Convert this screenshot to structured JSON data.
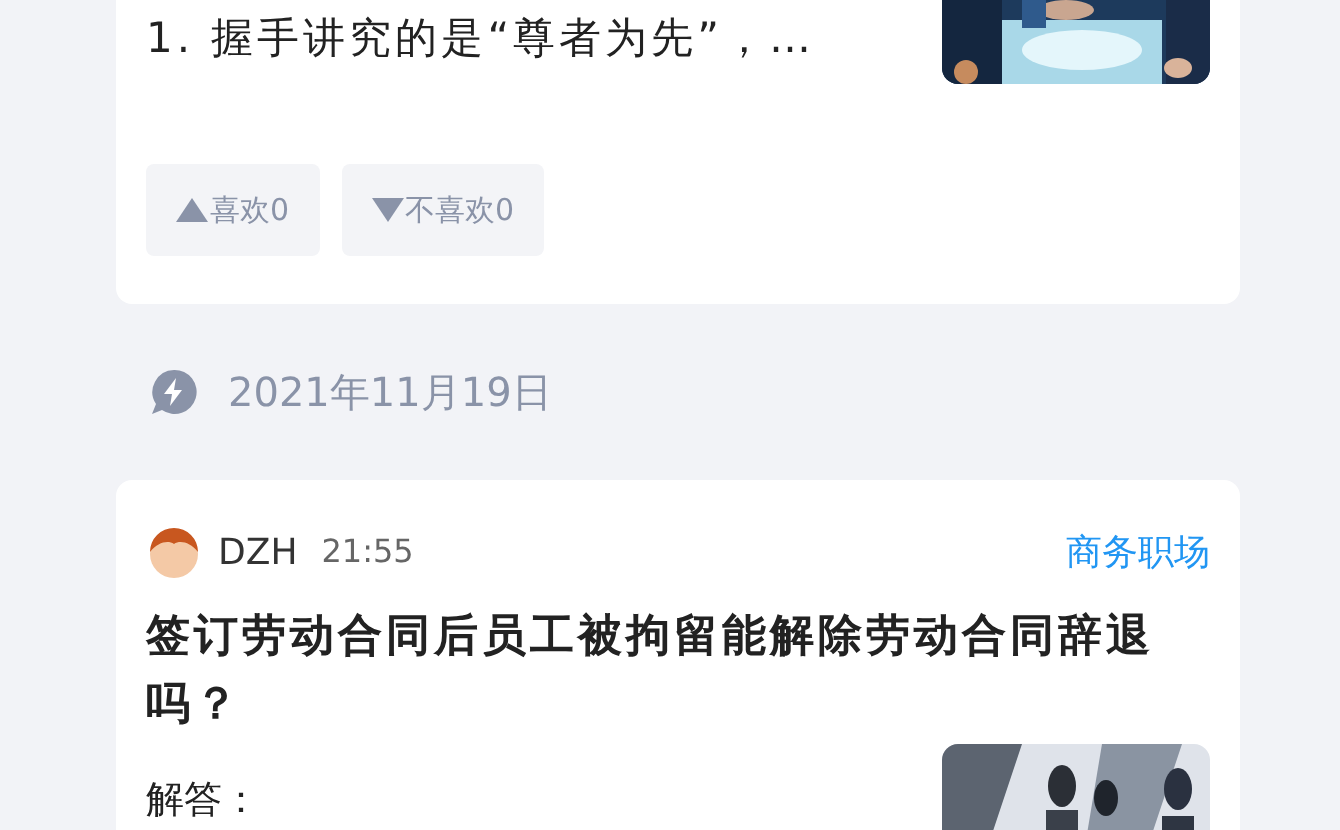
{
  "cards": [
    {
      "kind": "summary",
      "excerpt": "1. 握手讲究的是“尊者为先”，…",
      "reactions": [
        {
          "kind": "up",
          "label": "喜欢0"
        },
        {
          "kind": "down",
          "label": "不喜欢0"
        }
      ]
    },
    {
      "kind": "date",
      "date": "2021年11月19日"
    },
    {
      "kind": "post",
      "author": "DZH",
      "time": "21:55",
      "category": "商务职场",
      "title": "签订劳动合同后员工被拘留能解除劳动合同辞退吗？",
      "excerpt": "解答："
    }
  ]
}
